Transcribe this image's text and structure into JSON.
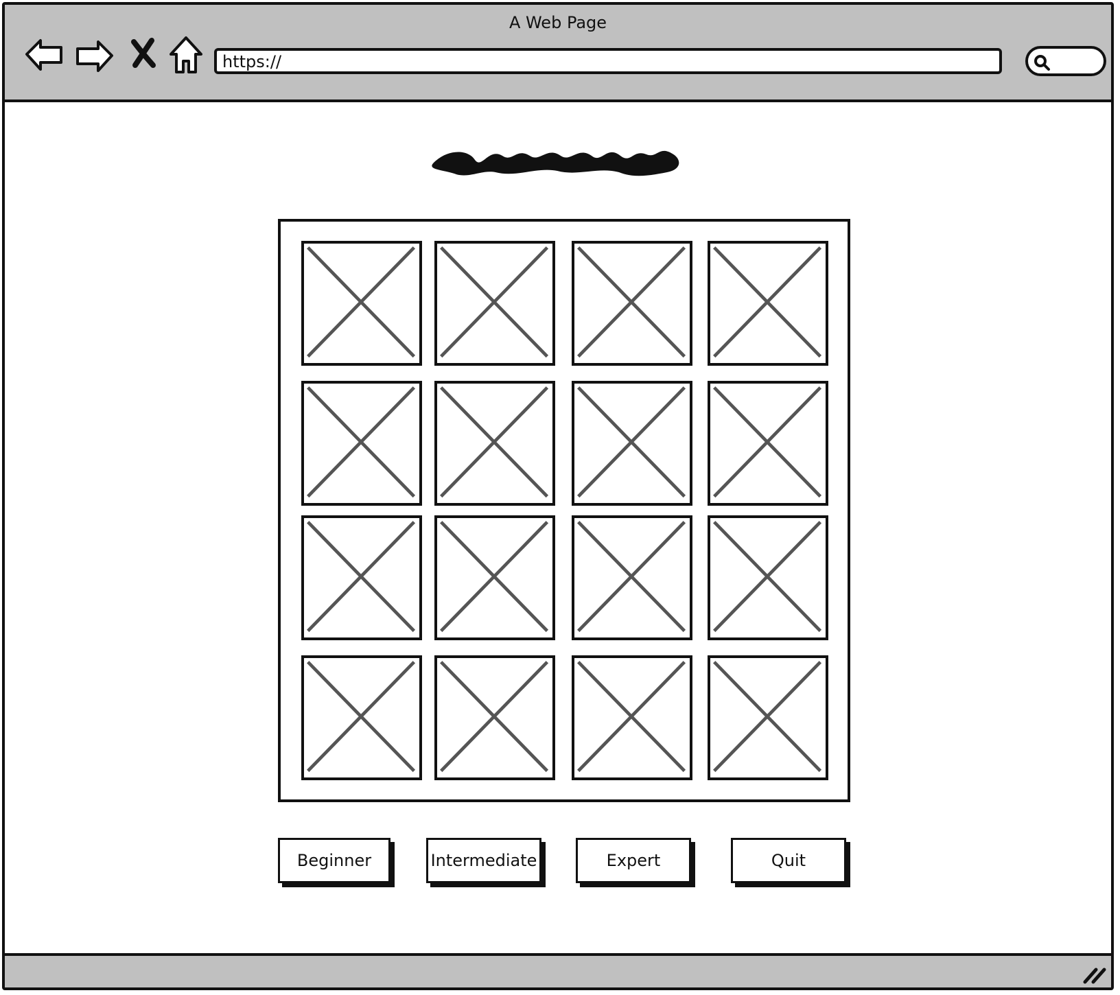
{
  "browser": {
    "title": "A Web Page",
    "url": "https://"
  },
  "board": {
    "rows": 4,
    "columns": 4,
    "tiles": [
      "image-placeholder",
      "image-placeholder",
      "image-placeholder",
      "image-placeholder",
      "image-placeholder",
      "image-placeholder",
      "image-placeholder",
      "image-placeholder",
      "image-placeholder",
      "image-placeholder",
      "image-placeholder",
      "image-placeholder",
      "image-placeholder",
      "image-placeholder",
      "image-placeholder",
      "image-placeholder"
    ]
  },
  "buttons": {
    "beginner": "Beginner",
    "intermediate": "Intermediate",
    "expert": "Expert",
    "quit": "Quit"
  },
  "colors": {
    "chrome": "#c0c0c0",
    "ink": "#111111",
    "placeholder_cross": "#555555"
  }
}
